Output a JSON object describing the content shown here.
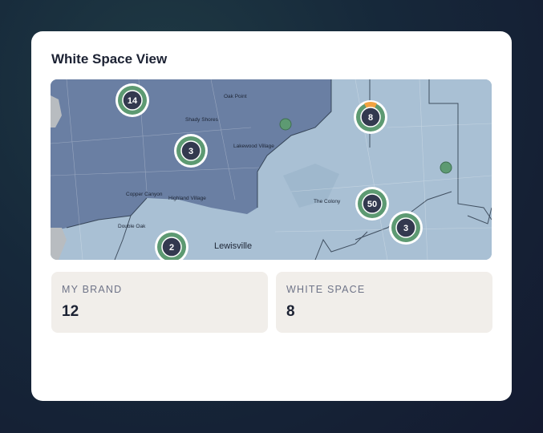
{
  "card": {
    "title": "White Space View"
  },
  "map": {
    "place_labels": {
      "oak_point": "Oak Point",
      "shady_shores": "Shady Shores",
      "lakewood_village": "Lakewood Village",
      "copper_canyon": "Copper Canyon",
      "highland_village": "Highland Village",
      "double_oak": "Double Oak",
      "the_colony": "The Colony",
      "lewisville": "Lewisville"
    },
    "clusters": {
      "c14": "14",
      "c3a": "3",
      "c8": "8",
      "c50": "50",
      "c3b": "3",
      "c2": "2"
    },
    "colors": {
      "owned_territory": "#6a7fa3",
      "white_space": "#a9c0d4",
      "cluster_ring": "#5d9a72",
      "cluster_core": "#33394f",
      "cluster_alert": "#f2a341"
    }
  },
  "stats": {
    "my_brand": {
      "label": "MY BRAND",
      "value": "12"
    },
    "white_space": {
      "label": "WHITE SPACE",
      "value": "8"
    }
  }
}
